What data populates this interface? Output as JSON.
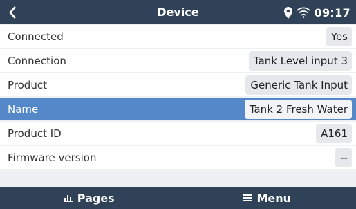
{
  "header": {
    "title": "Device",
    "time": "09:17",
    "icons": [
      "back-chevron-icon",
      "location-pin-icon",
      "wifi-icon"
    ]
  },
  "rows": [
    {
      "label": "Connected",
      "value": "Yes"
    },
    {
      "label": "Connection",
      "value": "Tank Level input 3"
    },
    {
      "label": "Product",
      "value": "Generic Tank Input"
    },
    {
      "label": "Name",
      "value": "Tank 2 Fresh Water",
      "selected": true
    },
    {
      "label": "Product ID",
      "value": "A161"
    },
    {
      "label": "Firmware version",
      "value": "--"
    }
  ],
  "footer": {
    "pages_label": "Pages",
    "menu_label": "Menu",
    "icons": [
      "bar-chart-icon",
      "hamburger-menu-icon"
    ]
  },
  "colors": {
    "header_bg": "#2f4257",
    "selected_row": "#5488c9",
    "row_bg": "#ffffff",
    "value_box": "#e6e8eb"
  }
}
